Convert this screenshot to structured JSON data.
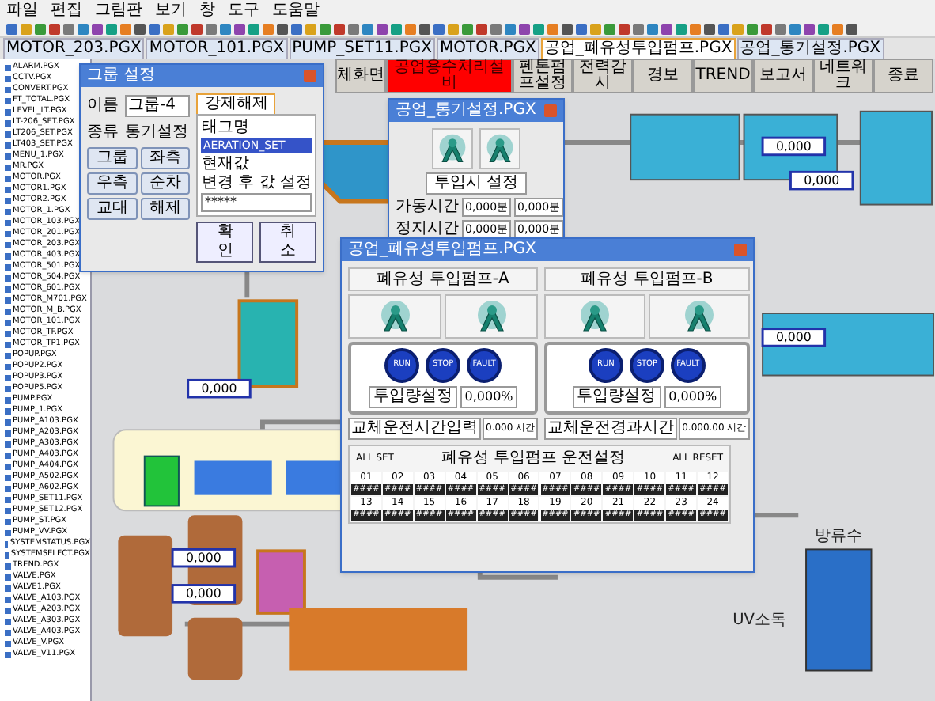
{
  "menu": [
    "파일",
    "편집",
    "그림판",
    "보기",
    "창",
    "도구",
    "도움말"
  ],
  "tabs": [
    {
      "label": "MOTOR_203.PGX",
      "selected": false
    },
    {
      "label": "MOTOR_101.PGX",
      "selected": false
    },
    {
      "label": "PUMP_SET11.PGX",
      "selected": false
    },
    {
      "label": "MOTOR.PGX",
      "selected": false
    },
    {
      "label": "공업_폐유성투입펌프.PGX",
      "selected": true
    },
    {
      "label": "공업_통기설정.PGX",
      "selected": false
    }
  ],
  "files": [
    "ALARM.PGX",
    "CCTV.PGX",
    "CONVERT.PGX",
    "FT_TOTAL.PGX",
    "LEVEL_LT.PGX",
    "LT-206_SET.PGX",
    "LT206_SET.PGX",
    "LT403_SET.PGX",
    "MENU_1.PGX",
    "MR.PGX",
    "MOTOR.PGX",
    "MOTOR1.PGX",
    "MOTOR2.PGX",
    "MOTOR_1.PGX",
    "MOTOR_103.PGX",
    "MOTOR_201.PGX",
    "MOTOR_203.PGX",
    "MOTOR_403.PGX",
    "MOTOR_501.PGX",
    "MOTOR_504.PGX",
    "MOTOR_601.PGX",
    "MOTOR_M701.PGX",
    "MOTOR_M_B.PGX",
    "MOTOR_101.PGX",
    "MOTOR_TF.PGX",
    "MOTOR_TP1.PGX",
    "POPUP.PGX",
    "POPUP2.PGX",
    "POPUP3.PGX",
    "POPUP5.PGX",
    "PUMP.PGX",
    "PUMP_1.PGX",
    "PUMP_A103.PGX",
    "PUMP_A203.PGX",
    "PUMP_A303.PGX",
    "PUMP_A403.PGX",
    "PUMP_A404.PGX",
    "PUMP_A502.PGX",
    "PUMP_A602.PGX",
    "PUMP_SET11.PGX",
    "PUMP_SET12.PGX",
    "PUMP_ST.PGX",
    "PUMP_VV.PGX",
    "SYSTEMSTATUS.PGX",
    "SYSTEMSELECT.PGX",
    "TREND.PGX",
    "VALVE.PGX",
    "VALVE1.PGX",
    "VALVE_A103.PGX",
    "VALVE_A203.PGX",
    "VALVE_A303.PGX",
    "VALVE_A403.PGX",
    "VALVE_V.PGX",
    "VALVE_V11.PGX"
  ],
  "nav": [
    {
      "label": "체화면",
      "selected": false
    },
    {
      "label": "공업용수처리설비",
      "selected": true
    },
    {
      "label": "펜톤펌프설정",
      "selected": false
    },
    {
      "label": "전력감시",
      "selected": false
    },
    {
      "label": "경보",
      "selected": false
    },
    {
      "label": "TREND",
      "selected": false
    },
    {
      "label": "보고서",
      "selected": false
    },
    {
      "label": "네트워크",
      "selected": false
    },
    {
      "label": "종료",
      "selected": false
    }
  ],
  "canvas_texts": [
    {
      "kind": "readout",
      "text": "0,000"
    },
    {
      "kind": "readout",
      "text": "0,000"
    },
    {
      "kind": "readout",
      "text": "0,000"
    },
    {
      "kind": "readout",
      "text": "0,000"
    },
    {
      "kind": "readout",
      "text": "0,000"
    },
    {
      "kind": "readout",
      "text": "0,000"
    },
    {
      "kind": "label",
      "text": "UV소독"
    },
    {
      "kind": "label",
      "text": "방류수"
    }
  ],
  "group_dialog": {
    "title": "그룹 설정",
    "name_label": "이름",
    "name_value": "그룹-4",
    "type_label": "종류",
    "type_value": "통기설정",
    "buttons": [
      "그룹",
      "좌측",
      "우측",
      "순차",
      "교대",
      "해제"
    ],
    "tab": "강제해제",
    "tag_label": "태그명",
    "tag_value": "AERATION_SET",
    "current_label": "현재값",
    "new_label": "변경 후 값 설정",
    "new_value": "*****",
    "ok": "확인",
    "cancel": "취소"
  },
  "aeration_window": {
    "title": "공업_통기설정.PGX",
    "heading": "투입시 설정",
    "rows": [
      {
        "label": "가동시간",
        "values": [
          "0,000분",
          "0,000분"
        ]
      },
      {
        "label": "정지시간",
        "values": [
          "0,000분",
          "0,000분"
        ]
      }
    ]
  },
  "pump_window": {
    "title": "공업_폐유성투입펌프.PGX",
    "pumps": [
      {
        "name": "폐유성 투입펌프-A",
        "lamps": [
          "RUN",
          "STOP",
          "FAULT"
        ],
        "setpoint_label": "투입량설정",
        "setpoint_value": "0,000%",
        "runtime_label": "교체운전시간입력",
        "runtime_value": "0.000 시간"
      },
      {
        "name": "폐유성 투입펌프-B",
        "lamps": [
          "RUN",
          "STOP",
          "FAULT"
        ],
        "setpoint_label": "투입량설정",
        "setpoint_value": "0,000%",
        "runtime_label": "교체운전경과시간",
        "runtime_value": "0.000.00 시간"
      }
    ],
    "schedule": {
      "all_set": "ALL SET",
      "title": "폐유성 투입펌프 운전설정",
      "all_reset": "ALL RESET",
      "cells": [
        {
          "number": "01",
          "value": "####"
        },
        {
          "number": "02",
          "value": "####"
        },
        {
          "number": "03",
          "value": "####"
        },
        {
          "number": "04",
          "value": "####"
        },
        {
          "number": "05",
          "value": "####"
        },
        {
          "number": "06",
          "value": "####"
        },
        {
          "number": "07",
          "value": "####"
        },
        {
          "number": "08",
          "value": "####"
        },
        {
          "number": "09",
          "value": "####"
        },
        {
          "number": "10",
          "value": "####"
        },
        {
          "number": "11",
          "value": "####"
        },
        {
          "number": "12",
          "value": "####"
        },
        {
          "number": "13",
          "value": "####"
        },
        {
          "number": "14",
          "value": "####"
        },
        {
          "number": "15",
          "value": "####"
        },
        {
          "number": "16",
          "value": "####"
        },
        {
          "number": "17",
          "value": "####"
        },
        {
          "number": "18",
          "value": "####"
        },
        {
          "number": "19",
          "value": "####"
        },
        {
          "number": "20",
          "value": "####"
        },
        {
          "number": "21",
          "value": "####"
        },
        {
          "number": "22",
          "value": "####"
        },
        {
          "number": "23",
          "value": "####"
        },
        {
          "number": "24",
          "value": "####"
        }
      ]
    }
  }
}
